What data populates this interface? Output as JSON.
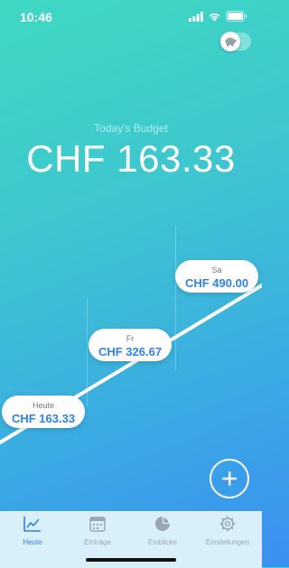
{
  "status": {
    "time": "10:46"
  },
  "header": {
    "toggle_icon": "piggy-bank-icon"
  },
  "budget": {
    "label": "Today's Budget",
    "amount": "CHF 163.33"
  },
  "forecast": [
    {
      "day": "Heute",
      "amount": "CHF 163.33"
    },
    {
      "day": "Fr",
      "amount": "CHF 326.67"
    },
    {
      "day": "Sa",
      "amount": "CHF 490.00"
    }
  ],
  "actions": {
    "add_icon": "plus-icon"
  },
  "tabs": [
    {
      "label": "Heute",
      "icon": "chart-line-icon",
      "active": true
    },
    {
      "label": "Einträge",
      "icon": "calendar-icon",
      "active": false
    },
    {
      "label": "Einblicke",
      "icon": "pie-chart-icon",
      "active": false
    },
    {
      "label": "Einstellungen",
      "icon": "gear-icon",
      "active": false
    }
  ],
  "colors": {
    "accent": "#2f82e8",
    "gradient_top": "#3fd9c2",
    "gradient_bottom": "#3b8ff0"
  }
}
